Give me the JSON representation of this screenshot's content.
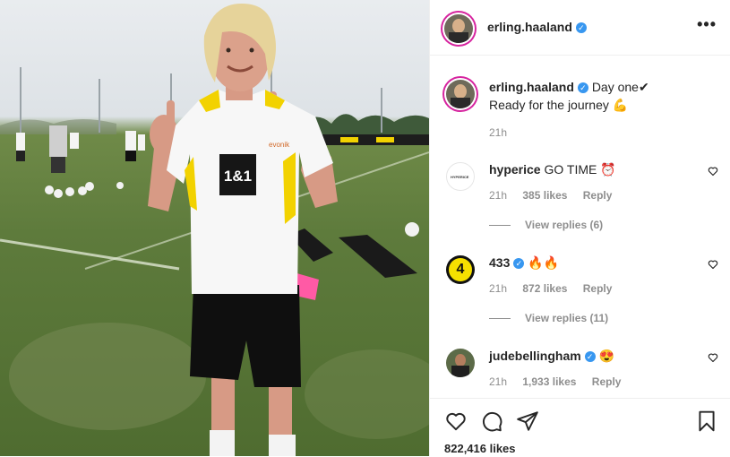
{
  "post": {
    "author": "erling.haaland",
    "caption_line1": "Day one✔",
    "caption_line2": "Ready for the journey 💪",
    "age": "21h",
    "likes": "822,416 likes"
  },
  "header": {
    "more_label": "•••"
  },
  "comments": [
    {
      "user": "hyperice",
      "text": "GO TIME ⏰",
      "age": "21h",
      "likes": "385 likes",
      "reply": "Reply",
      "view_replies": "View replies (6)",
      "avatar_text": "HYPERICE"
    },
    {
      "user": "433",
      "text": "🔥🔥",
      "age": "21h",
      "likes": "872 likes",
      "reply": "Reply",
      "view_replies": "View replies (11)",
      "avatar_text": "4"
    },
    {
      "user": "judebellingham",
      "text": "😍",
      "age": "21h",
      "likes": "1,933 likes",
      "reply": "Reply"
    }
  ],
  "photo": {
    "shirt_sponsor": "1&1",
    "shirt_brand": "evonik"
  },
  "colors": {
    "verified": "#3897f0",
    "meta": "#8e8e8e",
    "story_ring": "#d6249f"
  },
  "icons": [
    "more-options-icon",
    "heart-icon",
    "comment-icon",
    "share-icon",
    "bookmark-icon",
    "verified-icon"
  ]
}
